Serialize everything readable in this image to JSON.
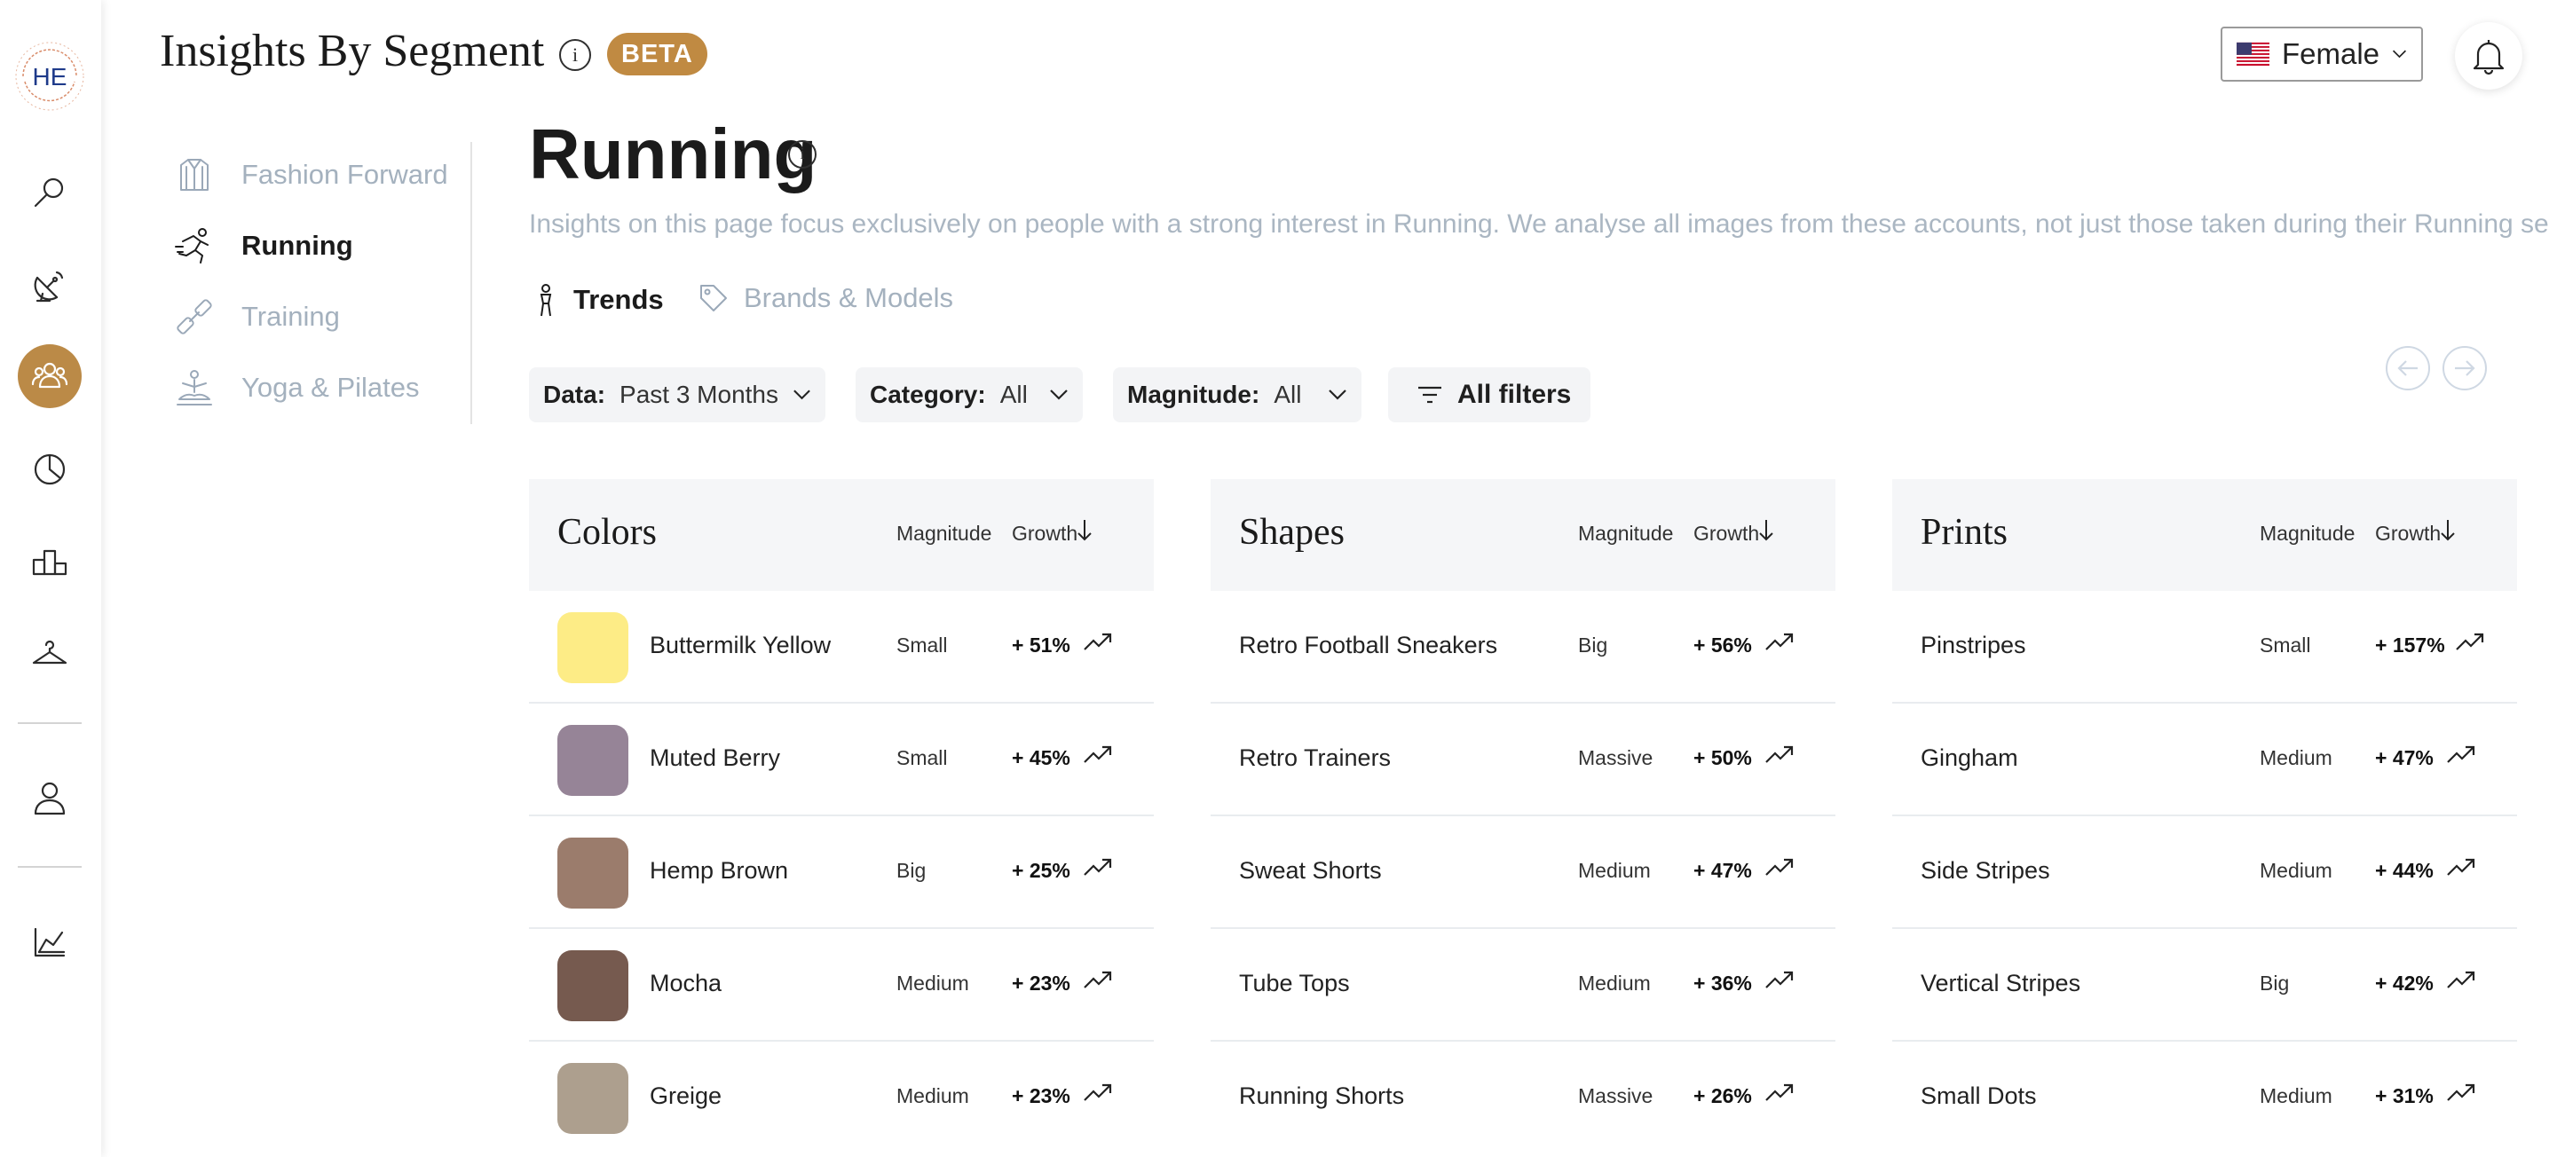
{
  "app": {
    "title": "Insights By Segment",
    "badge": "BETA",
    "logo_text": "HE"
  },
  "header": {
    "country_flag": "us-flag-icon",
    "audience_selected": "Female"
  },
  "sidebar_icons": [
    "search-icon",
    "satellite-icon",
    "people-icon",
    "pie-chart-icon",
    "podium-icon",
    "hanger-icon",
    "person-icon",
    "book-chart-icon"
  ],
  "segments": [
    {
      "label": "Fashion Forward",
      "icon": "jacket-icon",
      "active": false
    },
    {
      "label": "Running",
      "icon": "runner-icon",
      "active": true
    },
    {
      "label": "Training",
      "icon": "dumbbell-icon",
      "active": false
    },
    {
      "label": "Yoga & Pilates",
      "icon": "yoga-icon",
      "active": false
    }
  ],
  "page": {
    "title": "Running",
    "description": "Insights on this page focus exclusively on people with a strong interest in Running. We analyse all images from these accounts, not just those taken during their Running session."
  },
  "tabs": [
    {
      "label": "Trends",
      "icon": "trend-icon",
      "active": true
    },
    {
      "label": "Brands & Models",
      "icon": "tag-icon",
      "active": false
    }
  ],
  "filters": {
    "data": {
      "key": "Data:",
      "value": "Past 3 Months"
    },
    "category": {
      "key": "Category:",
      "value": "All"
    },
    "magnitude": {
      "key": "Magnitude:",
      "value": "All"
    },
    "all_filters_label": "All filters"
  },
  "columns": {
    "magnitude": "Magnitude",
    "growth": "Growth"
  },
  "panels": [
    {
      "title": "Colors",
      "rows": [
        {
          "name": "Buttermilk Yellow",
          "swatch": "#fdec86",
          "magnitude": "Small",
          "growth": "+ 51%"
        },
        {
          "name": "Muted Berry",
          "swatch": "#968497",
          "magnitude": "Small",
          "growth": "+ 45%"
        },
        {
          "name": "Hemp Brown",
          "swatch": "#9b7c6c",
          "magnitude": "Big",
          "growth": "+ 25%"
        },
        {
          "name": "Mocha",
          "swatch": "#765a4f",
          "magnitude": "Medium",
          "growth": "+ 23%"
        },
        {
          "name": "Greige",
          "swatch": "#ad9f8e",
          "magnitude": "Medium",
          "growth": "+ 23%"
        }
      ]
    },
    {
      "title": "Shapes",
      "rows": [
        {
          "name": "Retro Football Sneakers",
          "magnitude": "Big",
          "growth": "+ 56%"
        },
        {
          "name": "Retro Trainers",
          "magnitude": "Massive",
          "growth": "+ 50%"
        },
        {
          "name": "Sweat Shorts",
          "magnitude": "Medium",
          "growth": "+ 47%"
        },
        {
          "name": "Tube Tops",
          "magnitude": "Medium",
          "growth": "+ 36%"
        },
        {
          "name": "Running Shorts",
          "magnitude": "Massive",
          "growth": "+ 26%"
        }
      ]
    },
    {
      "title": "Prints",
      "rows": [
        {
          "name": "Pinstripes",
          "magnitude": "Small",
          "growth": "+ 157%"
        },
        {
          "name": "Gingham",
          "magnitude": "Medium",
          "growth": "+ 47%"
        },
        {
          "name": "Side Stripes",
          "magnitude": "Medium",
          "growth": "+ 44%"
        },
        {
          "name": "Vertical Stripes",
          "magnitude": "Big",
          "growth": "+ 42%"
        },
        {
          "name": "Small Dots",
          "magnitude": "Medium",
          "growth": "+ 31%"
        }
      ]
    }
  ],
  "colors": {
    "accent": "#bb8a47",
    "muted_text": "#a4b1be",
    "panel_header_bg": "#f5f6f8"
  }
}
